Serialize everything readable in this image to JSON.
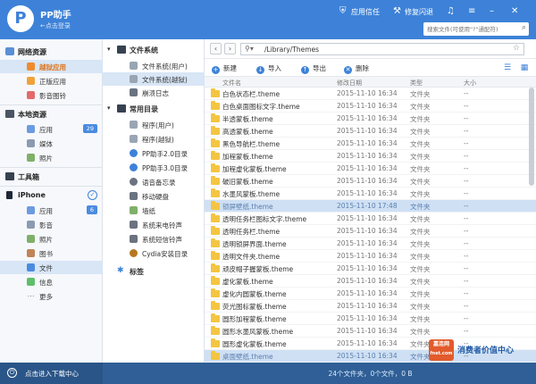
{
  "app": {
    "logo_text": "P",
    "name": "PP助手",
    "login_text": "←点击登录"
  },
  "titlebar": {
    "trust_label": "应用信任",
    "crash_label": "修复闪退",
    "search_placeholder": "搜索文件(可使用\"?\"通配符)"
  },
  "leftnav": {
    "network_header": "网络资源",
    "network_items": [
      {
        "label": "越狱应用"
      },
      {
        "label": "正版应用"
      },
      {
        "label": "影音图铃"
      }
    ],
    "local_header": "本地资源",
    "local_items": [
      {
        "label": "应用",
        "badge": "29"
      },
      {
        "label": "媒体"
      },
      {
        "label": "照片"
      }
    ],
    "toolbox_header": "工具箱",
    "device_header": "iPhone",
    "device_items": [
      {
        "label": "应用",
        "badge": "6"
      },
      {
        "label": "影音"
      },
      {
        "label": "照片"
      },
      {
        "label": "图书"
      },
      {
        "label": "文件"
      },
      {
        "label": "信息"
      },
      {
        "label": "更多"
      }
    ]
  },
  "tree": {
    "fs_header": "文件系统",
    "fs_items": [
      {
        "label": "文件系统(用户)"
      },
      {
        "label": "文件系统(越狱)"
      },
      {
        "label": "崩溃日志"
      }
    ],
    "common_header": "常用目录",
    "common_items": [
      {
        "label": "程序(用户)"
      },
      {
        "label": "程序(越狱)"
      },
      {
        "label": "PP助手2.0目录"
      },
      {
        "label": "PP助手3.0目录"
      },
      {
        "label": "语音备忘录"
      },
      {
        "label": "移动硬盘"
      },
      {
        "label": "墙纸"
      },
      {
        "label": "系统来电铃声"
      },
      {
        "label": "系统短信铃声"
      },
      {
        "label": "Cydia安装目录"
      }
    ],
    "tags_header": "标签"
  },
  "pathbar": {
    "back": "‹",
    "forward": "›",
    "path": "/Library/Themes"
  },
  "toolbar": {
    "new_label": "新建",
    "import_label": "导入",
    "export_label": "导出",
    "delete_label": "删除"
  },
  "table": {
    "headers": {
      "name": "文件名",
      "date": "修改日期",
      "type": "类型",
      "size": "大小"
    },
    "rows": [
      {
        "name": "白色状态栏.theme",
        "date": "2015-11-10 16:34",
        "type": "文件夹",
        "size": "--"
      },
      {
        "name": "白色桌面图标文字.theme",
        "date": "2015-11-10 16:34",
        "type": "文件夹",
        "size": "--"
      },
      {
        "name": "半透蒙板.theme",
        "date": "2015-11-10 16:34",
        "type": "文件夹",
        "size": "--"
      },
      {
        "name": "高透蒙板.theme",
        "date": "2015-11-10 16:34",
        "type": "文件夹",
        "size": "--"
      },
      {
        "name": "黑色导航栏.theme",
        "date": "2015-11-10 16:34",
        "type": "文件夹",
        "size": "--"
      },
      {
        "name": "加程蒙板.theme",
        "date": "2015-11-10 16:34",
        "type": "文件夹",
        "size": "--"
      },
      {
        "name": "加程虚化蒙板.theme",
        "date": "2015-11-10 16:34",
        "type": "文件夹",
        "size": "--"
      },
      {
        "name": "破旧蒙板.theme",
        "date": "2015-11-10 16:34",
        "type": "文件夹",
        "size": "--"
      },
      {
        "name": "水墨风蒙板.theme",
        "date": "2015-11-10 16:34",
        "type": "文件夹",
        "size": "--"
      },
      {
        "name": "锁屏壁纸.theme",
        "date": "2015-11-10 17:48",
        "type": "文件夹",
        "size": "--",
        "selected": true
      },
      {
        "name": "透明任务栏图标文字.theme",
        "date": "2015-11-10 16:34",
        "type": "文件夹",
        "size": "--"
      },
      {
        "name": "透明任务栏.theme",
        "date": "2015-11-10 16:34",
        "type": "文件夹",
        "size": "--"
      },
      {
        "name": "透明锁屏界面.theme",
        "date": "2015-11-10 16:34",
        "type": "文件夹",
        "size": "--"
      },
      {
        "name": "透明文件夹.theme",
        "date": "2015-11-10 16:34",
        "type": "文件夹",
        "size": "--"
      },
      {
        "name": "顽皮帽子握蒙板.theme",
        "date": "2015-11-10 16:34",
        "type": "文件夹",
        "size": "--"
      },
      {
        "name": "虚化蒙板.theme",
        "date": "2015-11-10 16:34",
        "type": "文件夹",
        "size": "--"
      },
      {
        "name": "虚化内圆蒙板.theme",
        "date": "2015-11-10 16:34",
        "type": "文件夹",
        "size": "--"
      },
      {
        "name": "荧光图标蒙板.theme",
        "date": "2015-11-10 16:34",
        "type": "文件夹",
        "size": "--"
      },
      {
        "name": "圆形加程蒙板.theme",
        "date": "2015-11-10 16:34",
        "type": "文件夹",
        "size": "--"
      },
      {
        "name": "圆形水墨风蒙板.theme",
        "date": "2015-11-10 16:34",
        "type": "文件夹",
        "size": "--"
      },
      {
        "name": "圆形虚化蒙板.theme",
        "date": "2015-11-10 16:34",
        "type": "文件夹",
        "size": "--"
      },
      {
        "name": "桌面壁纸.theme",
        "date": "2015-11-10 16:34",
        "type": "文件夹",
        "size": "--",
        "selected": true
      }
    ]
  },
  "statusbar": {
    "download_label": "点击进入下载中心",
    "summary": "24个文件夹，0个文件，0 B"
  },
  "watermark": {
    "badge": "嘉连网",
    "badge_sub": "fnet.com",
    "text": "消费者价值中心"
  },
  "colors": {
    "accent": "#3d82d8",
    "selected_row": "#cfe0f4",
    "folder": "#f4c542"
  }
}
